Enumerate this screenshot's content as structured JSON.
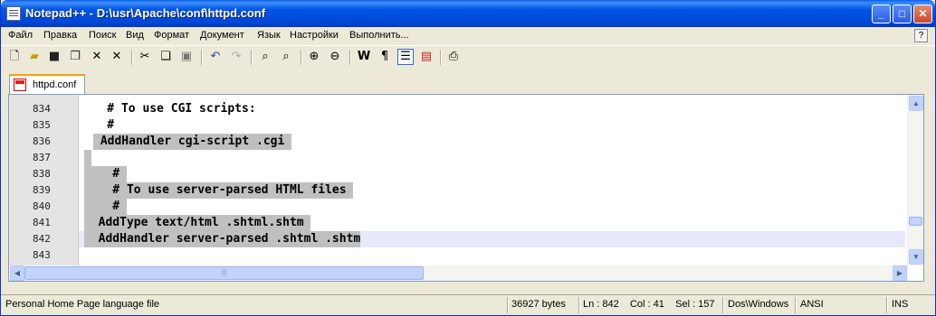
{
  "window": {
    "title": "Notepad++ - D:\\usr\\Apache\\conf\\httpd.conf",
    "minimize": "_",
    "maximize": "□",
    "close": "✕",
    "help": "?"
  },
  "menu": [
    "Файл",
    "Правка",
    "Поиск",
    "Вид",
    "Формат",
    "Документ",
    "Язык",
    "Настройки",
    "Выполнить..."
  ],
  "toolbar": {
    "buttons": [
      "new-file-icon",
      "open-file-icon",
      "save-icon",
      "save-all-icon",
      "close-icon",
      "close-all-icon",
      "cut-icon",
      "copy-icon",
      "paste-icon",
      "undo-icon",
      "redo-icon",
      "find-icon",
      "replace-icon",
      "zoom-in-icon",
      "zoom-out-icon",
      "wrap-icon",
      "show-all-chars-icon",
      "indent-guide-icon",
      "user-lang-icon",
      "print-icon"
    ]
  },
  "tabs": [
    {
      "label": "httpd.conf",
      "active": true
    }
  ],
  "editor": {
    "lines": [
      {
        "num": "834",
        "text": "    # To use CGI scripts:"
      },
      {
        "num": "835",
        "text": "    #"
      },
      {
        "num": "836",
        "text": " AddHandler cgi-script .cgi "
      },
      {
        "num": "837",
        "text": ""
      },
      {
        "num": "838",
        "text": "    # "
      },
      {
        "num": "839",
        "text": "    # To use server-parsed HTML files "
      },
      {
        "num": "840",
        "text": "    # "
      },
      {
        "num": "841",
        "text": "  AddType text/html .shtml.shtm "
      },
      {
        "num": "842",
        "text": "  AddHandler server-parsed .shtml .shtm"
      },
      {
        "num": "843",
        "text": ""
      }
    ],
    "current_line": "842"
  },
  "status": {
    "language": "Personal Home Page language file",
    "size": "36927 bytes",
    "position": "Ln : 842    Col : 41    Sel : 157",
    "eol": "Dos\\Windows",
    "encoding": "ANSI",
    "mode": "INS"
  }
}
